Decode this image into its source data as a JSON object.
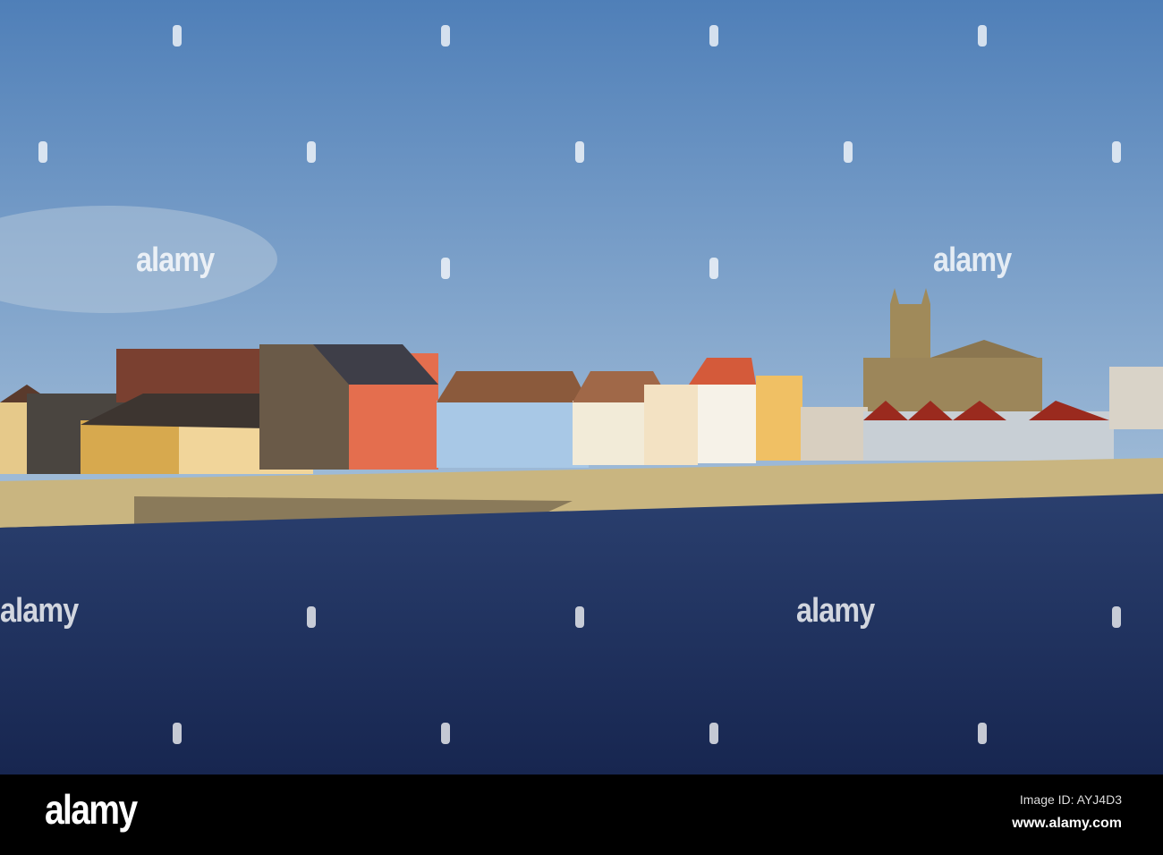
{
  "watermark": {
    "text": "alamy"
  },
  "footer": {
    "logo": "alamy",
    "image_id": "Image ID: AYJ4D3",
    "website": "www.alamy.com"
  },
  "colors": {
    "sky_top": "#4f7fb8",
    "sky_bottom": "#9bb8d6",
    "water": "#1d2f5a",
    "wall": "#c9b580"
  }
}
